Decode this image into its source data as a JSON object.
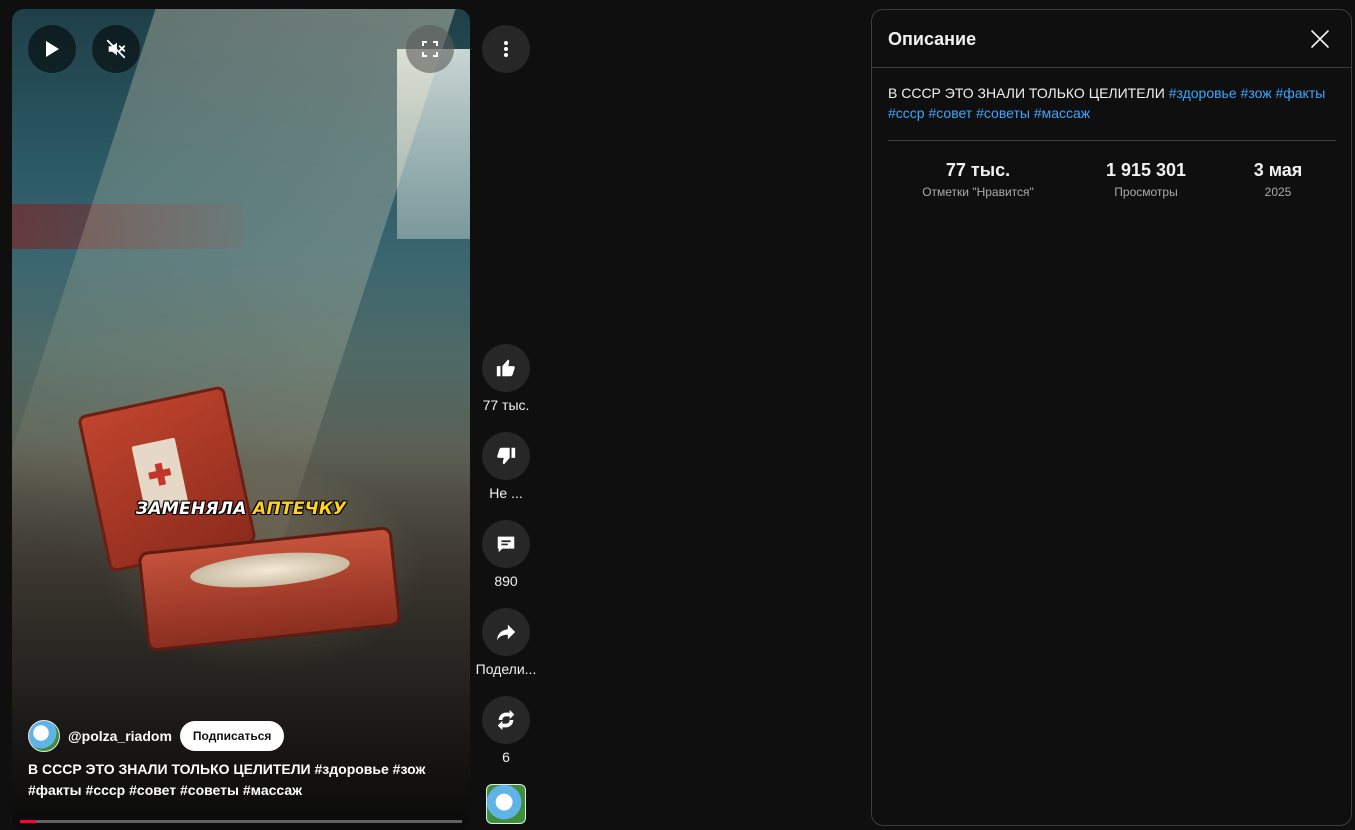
{
  "player": {
    "overlay_caption_white": "ЗАМЕНЯЛА",
    "overlay_caption_yellow": "АПТЕЧКУ",
    "channel_handle": "@polza_riadom",
    "subscribe_label": "Подписаться",
    "description_text": "В СССР ЭТО ЗНАЛИ ТОЛЬКО ЦЕЛИТЕЛИ #здоровье #зож #факты #ссср #совет #советы #массаж",
    "progress": 0.036,
    "icons": {
      "play": "play-icon",
      "mute": "volume-off-icon",
      "fullscreen": "fullscreen-icon"
    }
  },
  "actions": {
    "like_count": "77 тыс.",
    "dislike_label": "Не ...",
    "comment_count": "890",
    "share_label": "Подели...",
    "remix_count": "6"
  },
  "panel": {
    "title": "Описание",
    "description_plain": "В СССР ЭТО ЗНАЛИ ТОЛЬКО ЦЕЛИТЕЛИ ",
    "hashtags": [
      "#здоровье",
      "#зож",
      "#факты",
      "#ссср",
      "#совет",
      "#советы",
      "#массаж"
    ],
    "stats": [
      {
        "value": "77 тыс.",
        "label": "Отметки \"Нравится\""
      },
      {
        "value": "1 915 301",
        "label": "Просмотры"
      },
      {
        "value": "3 мая",
        "label": "2025"
      }
    ]
  },
  "colors": {
    "accent_link": "#3ea6ff",
    "progress_red": "#ff0033",
    "caption_yellow": "#ffd21f"
  }
}
